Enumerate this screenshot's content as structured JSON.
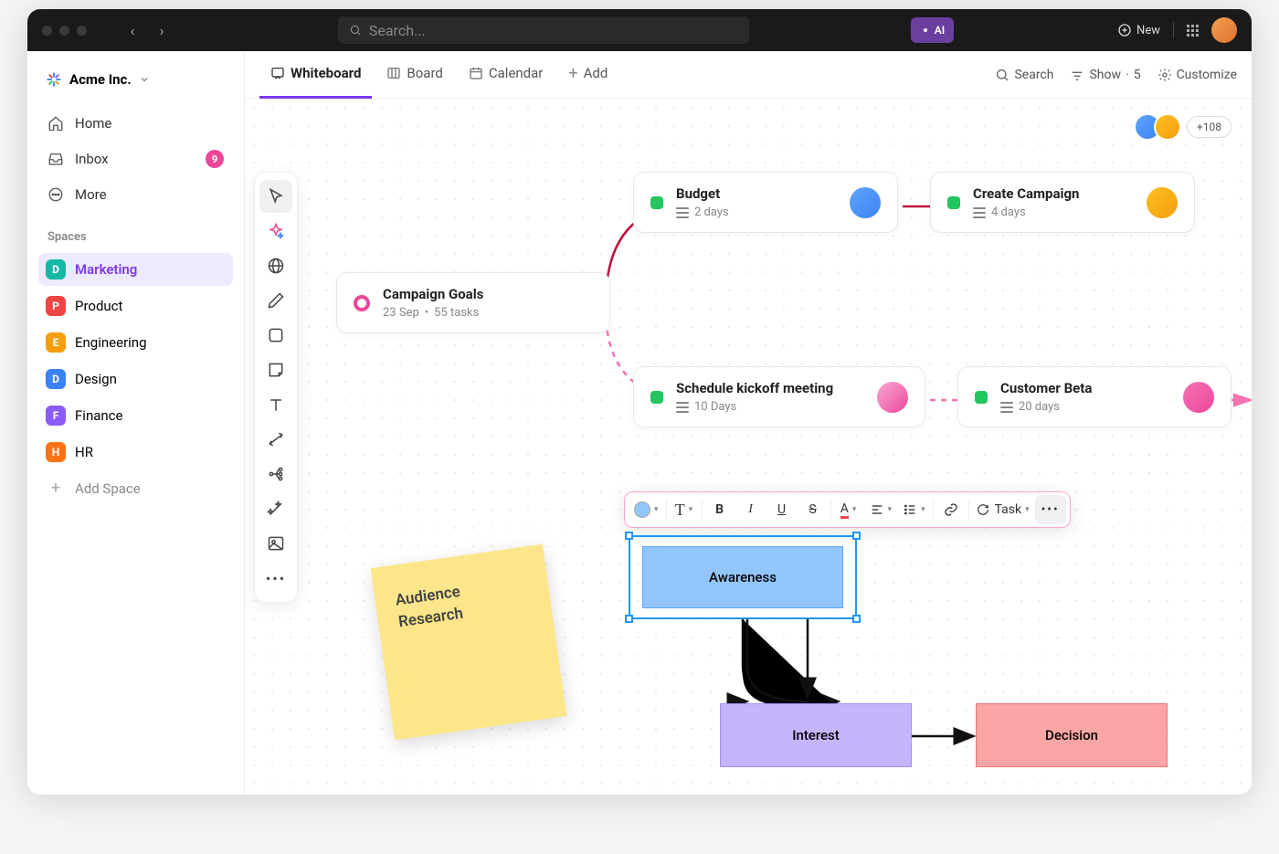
{
  "titlebar": {
    "search_placeholder": "Search...",
    "ai_label": "AI",
    "new_label": "New"
  },
  "workspace": {
    "name": "Acme Inc."
  },
  "sidebar": {
    "home": "Home",
    "inbox": "Inbox",
    "inbox_count": "9",
    "more": "More",
    "spaces_label": "Spaces",
    "add_space": "Add Space",
    "spaces": [
      {
        "letter": "D",
        "name": "Marketing",
        "color": "#14b8a6"
      },
      {
        "letter": "P",
        "name": "Product",
        "color": "#ef4444"
      },
      {
        "letter": "E",
        "name": "Engineering",
        "color": "#f59e0b"
      },
      {
        "letter": "D",
        "name": "Design",
        "color": "#3b82f6"
      },
      {
        "letter": "F",
        "name": "Finance",
        "color": "#8b5cf6"
      },
      {
        "letter": "H",
        "name": "HR",
        "color": "#f97316"
      }
    ]
  },
  "tabs": {
    "whiteboard": "Whiteboard",
    "board": "Board",
    "calendar": "Calendar",
    "add": "Add"
  },
  "toolbar_right": {
    "search": "Search",
    "show": "Show",
    "show_count": "5",
    "customize": "Customize"
  },
  "presence": {
    "more_count": "+108"
  },
  "cards": {
    "goals": {
      "title": "Campaign Goals",
      "date": "23 Sep",
      "tasks": "55 tasks"
    },
    "budget": {
      "title": "Budget",
      "duration": "2 days"
    },
    "create": {
      "title": "Create Campaign",
      "duration": "4 days"
    },
    "kickoff": {
      "title": "Schedule kickoff meeting",
      "duration": "10 Days"
    },
    "beta": {
      "title": "Customer Beta",
      "duration": "20 days"
    }
  },
  "sticky": {
    "line1": "Audience",
    "line2": "Research"
  },
  "shapes": {
    "awareness": "Awareness",
    "interest": "Interest",
    "decision": "Decision"
  },
  "format_toolbar": {
    "task_label": "Task"
  },
  "avatar_colors": {
    "p1": "linear-gradient(135deg,#fbbf24,#f59e0b)",
    "p2": "linear-gradient(135deg,#60a5fa,#3b82f6)",
    "p3": "linear-gradient(135deg,#f472b6,#ec4899)",
    "p4": "linear-gradient(135deg,#fb923c,#f97316)",
    "p5": "linear-gradient(135deg,#f9a8d4,#ec4899)"
  }
}
